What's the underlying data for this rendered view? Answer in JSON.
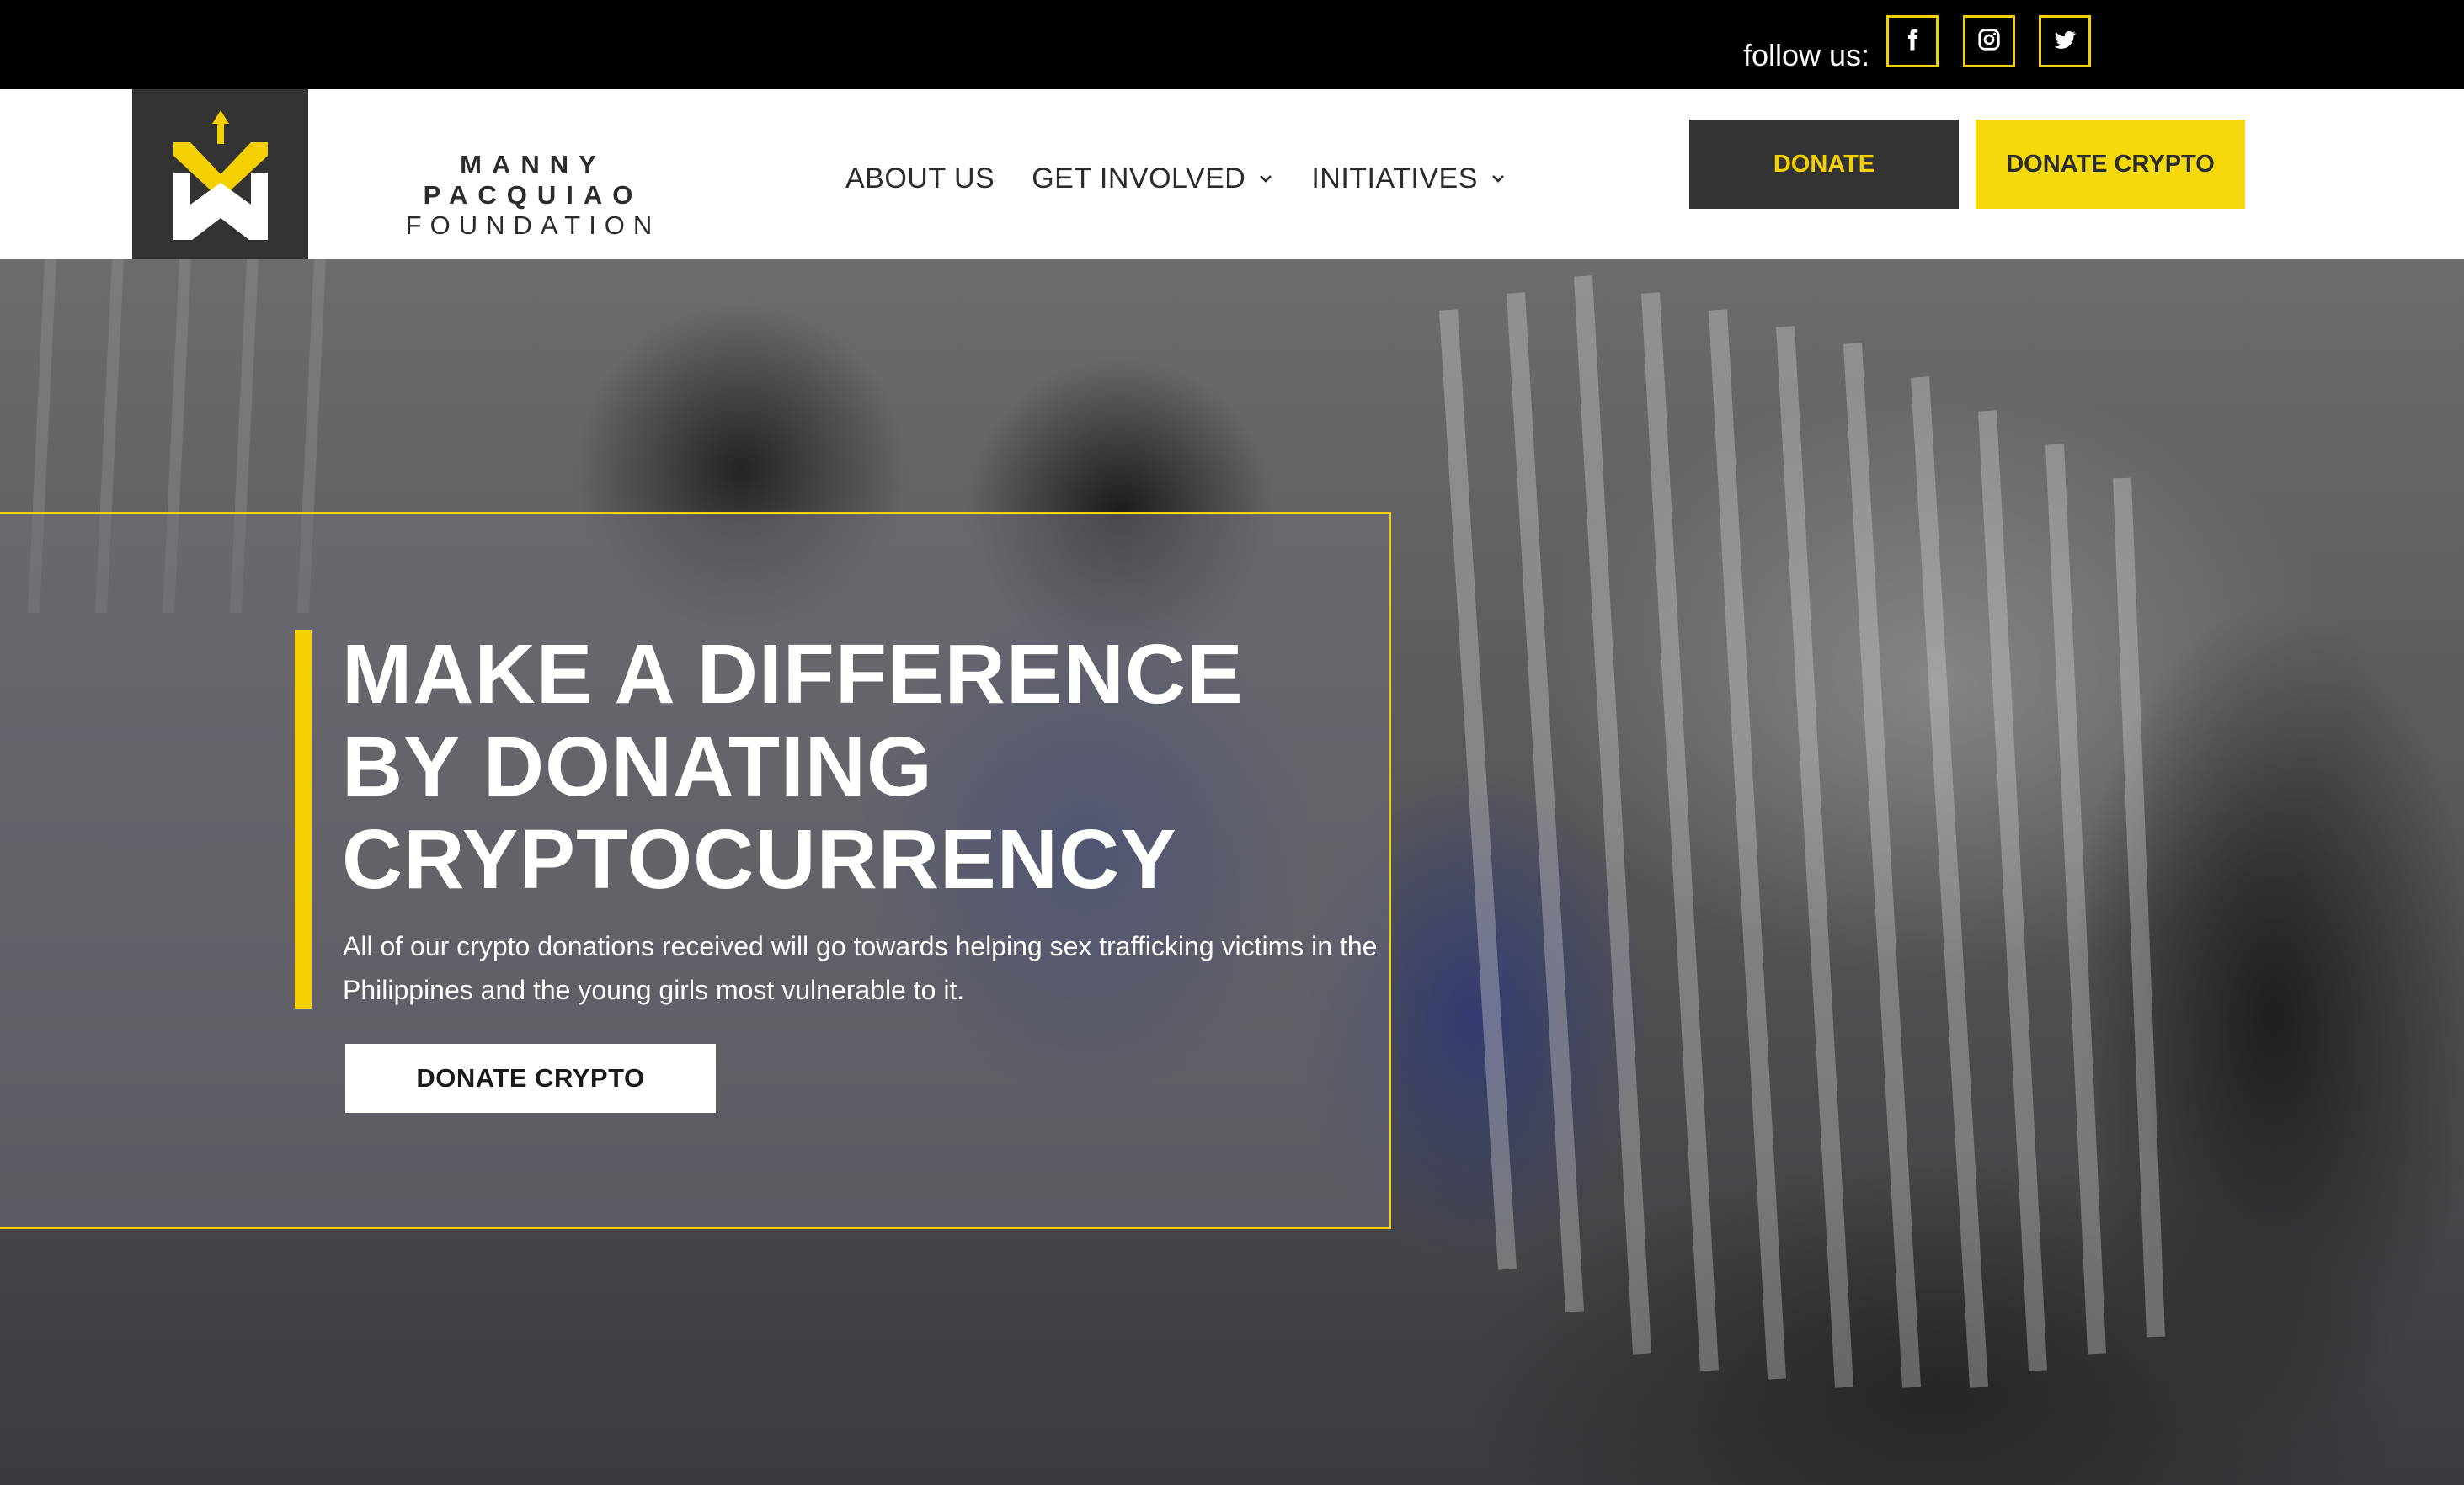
{
  "topbar": {
    "follow_label": "follow us:",
    "social": [
      {
        "icon": "facebook-icon"
      },
      {
        "icon": "instagram-icon"
      },
      {
        "icon": "twitter-icon"
      }
    ]
  },
  "header": {
    "brand_line1": "MANNY PACQUIAO",
    "brand_line2": "FOUNDATION",
    "nav": [
      {
        "label": "ABOUT US",
        "has_dropdown": false
      },
      {
        "label": "GET INVOLVED",
        "has_dropdown": true
      },
      {
        "label": "INITIATIVES",
        "has_dropdown": true
      }
    ],
    "donate_label": "DONATE",
    "donate_crypto_label": "DONATE CRYPTO"
  },
  "hero": {
    "title_lines": [
      "MAKE A DIFFERENCE",
      "BY DONATING",
      "CRYPTOCURRENCY"
    ],
    "text": "All of our crypto donations received will go towards helping sex trafficking victims in the Philippines and the young girls most vulnerable to it.",
    "button_label": "DONATE CRYPTO"
  },
  "colors": {
    "accent": "#f5d000",
    "dark": "#333333",
    "white": "#ffffff"
  }
}
